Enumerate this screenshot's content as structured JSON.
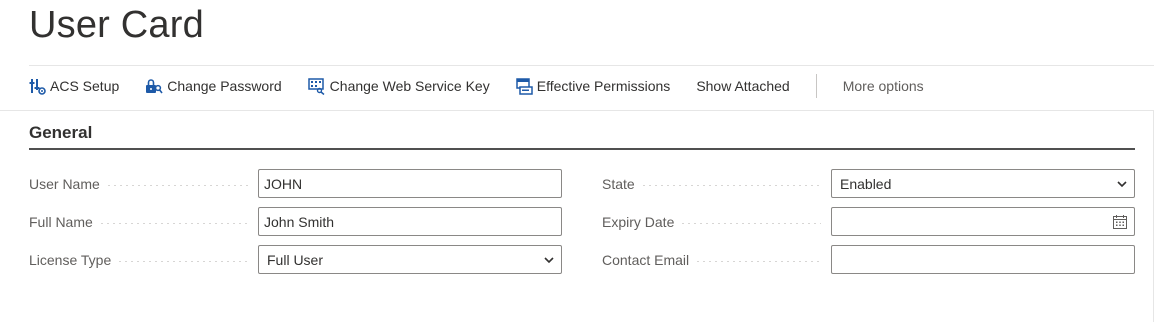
{
  "page": {
    "title": "User Card"
  },
  "actions": {
    "acs_setup": "ACS Setup",
    "change_password": "Change Password",
    "change_web_service_key": "Change Web Service Key",
    "effective_permissions": "Effective Permissions",
    "show_attached": "Show Attached",
    "more_options": "More options"
  },
  "icons": {
    "acs_setup": "acs-setup-icon",
    "change_password": "key-lock-icon",
    "change_web_service_key": "web-service-key-icon",
    "effective_permissions": "permissions-icon",
    "select": "chevron-down-icon",
    "date": "calendar-icon"
  },
  "section": {
    "title": "General"
  },
  "fields": {
    "user_name": {
      "label": "User Name",
      "value": "JOHN"
    },
    "full_name": {
      "label": "Full Name",
      "value": "John Smith"
    },
    "license_type": {
      "label": "License Type",
      "value": "Full User"
    },
    "state": {
      "label": "State",
      "value": "Enabled"
    },
    "expiry_date": {
      "label": "Expiry Date",
      "value": ""
    },
    "contact_email": {
      "label": "Contact Email",
      "value": ""
    }
  },
  "colors": {
    "text": "#323130",
    "label": "#605e5c",
    "icon_blue": "#1e5aa8",
    "border": "#8a8886",
    "section_rule": "#505050"
  }
}
